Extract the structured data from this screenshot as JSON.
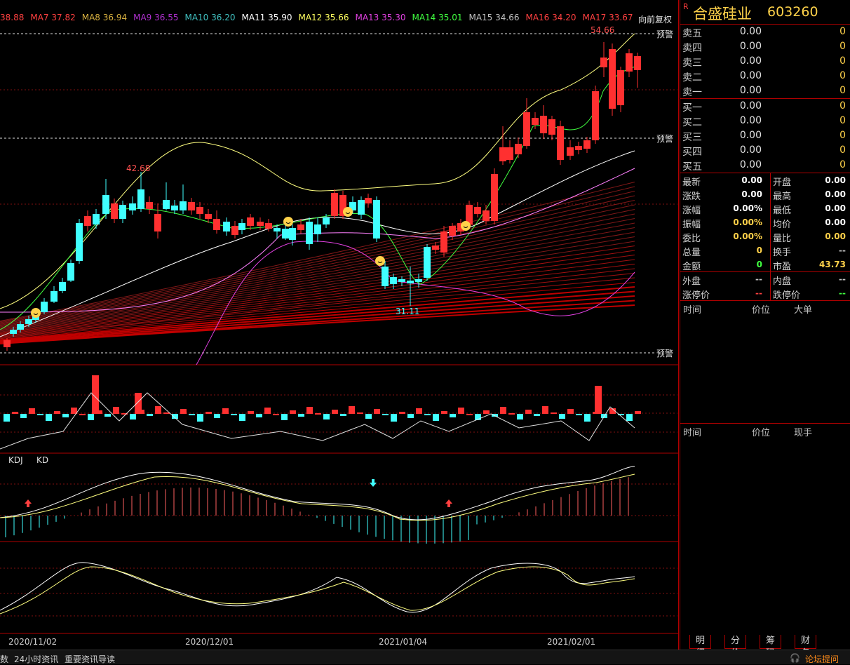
{
  "stock": {
    "flag": "R",
    "name": "合盛硅业",
    "code": "603260"
  },
  "ma_bar": [
    {
      "label": "38.88",
      "color": "#ff4040"
    },
    {
      "label": "MA7 37.82",
      "color": "#ff4040"
    },
    {
      "label": "MA8 36.94",
      "color": "#d7b040"
    },
    {
      "label": "MA9 36.55",
      "color": "#b030d0"
    },
    {
      "label": "MA10 36.20",
      "color": "#40c0c0"
    },
    {
      "label": "MA11 35.90",
      "color": "#ffffff"
    },
    {
      "label": "MA12 35.66",
      "color": "#ffff60"
    },
    {
      "label": "MA13 35.30",
      "color": "#e040e0"
    },
    {
      "label": "MA14 35.01",
      "color": "#40ff40"
    },
    {
      "label": "MA15 34.66",
      "color": "#c0c0c0"
    },
    {
      "label": "MA16 34.20",
      "color": "#ff4040"
    },
    {
      "label": "MA17 33.67",
      "color": "#ff4040"
    }
  ],
  "adjust_label": "向前复权",
  "warn_label": "预警",
  "price_annotations": {
    "high_left": "42.68",
    "high_right": "54.66",
    "low": "31.11"
  },
  "indicator_labels": {
    "kdj": "KDJ",
    "kd": "KD"
  },
  "x_axis_dates": [
    "2020/11/02",
    "2020/12/01",
    "2021/01/04",
    "2021/02/01"
  ],
  "orderbook": {
    "asks": [
      {
        "label": "卖五",
        "price": "0.00",
        "vol": "0"
      },
      {
        "label": "卖四",
        "price": "0.00",
        "vol": "0"
      },
      {
        "label": "卖三",
        "price": "0.00",
        "vol": "0"
      },
      {
        "label": "卖二",
        "price": "0.00",
        "vol": "0"
      },
      {
        "label": "卖一",
        "price": "0.00",
        "vol": "0"
      }
    ],
    "bids": [
      {
        "label": "买一",
        "price": "0.00",
        "vol": "0"
      },
      {
        "label": "买二",
        "price": "0.00",
        "vol": "0"
      },
      {
        "label": "买三",
        "price": "0.00",
        "vol": "0"
      },
      {
        "label": "买四",
        "price": "0.00",
        "vol": "0"
      },
      {
        "label": "买五",
        "price": "0.00",
        "vol": "0"
      }
    ]
  },
  "stats_a": [
    {
      "l1": "最新",
      "v1": "0.00",
      "c1": "#ffffff",
      "l2": "开盘",
      "v2": "0.00",
      "c2": "#ffffff"
    },
    {
      "l1": "涨跌",
      "v1": "0.00",
      "c1": "#ffffff",
      "l2": "最高",
      "v2": "0.00",
      "c2": "#ffffff"
    },
    {
      "l1": "涨幅",
      "v1": "0.00%",
      "c1": "#ffffff",
      "l2": "最低",
      "v2": "0.00",
      "c2": "#ffffff"
    },
    {
      "l1": "振幅",
      "v1": "0.00%",
      "c1": "#ffd24a",
      "l2": "均价",
      "v2": "0.00",
      "c2": "#ffffff"
    },
    {
      "l1": "委比",
      "v1": "0.00%",
      "c1": "#ffd24a",
      "l2": "量比",
      "v2": "0.00",
      "c2": "#ffd24a"
    },
    {
      "l1": "总量",
      "v1": "0",
      "c1": "#ffd24a",
      "l2": "换手",
      "v2": "--",
      "c2": "#c0c0c0"
    },
    {
      "l1": "金额",
      "v1": "0",
      "c1": "#40ff40",
      "l2": "市盈",
      "v2": "43.73",
      "c2": "#ffd24a"
    }
  ],
  "stats_b": [
    {
      "l1": "外盘",
      "v1": "--",
      "c1": "#c0c0c0",
      "l2": "内盘",
      "v2": "--",
      "c2": "#c0c0c0"
    },
    {
      "l1": "涨停价",
      "v1": "--",
      "c1": "#ff4040",
      "l2": "跌停价",
      "v2": "--",
      "c2": "#40ff40"
    }
  ],
  "trades_header": {
    "time": "时间",
    "price": "价位",
    "big": "大单"
  },
  "ticks_header": {
    "time": "时间",
    "price": "价位",
    "hand": "现手"
  },
  "tabs": [
    "明细",
    "分价",
    "筹码",
    "财务"
  ],
  "status": {
    "left": "数",
    "news1": "24小时资讯",
    "news2": "重要资讯导读",
    "forum": "论坛提问"
  }
}
